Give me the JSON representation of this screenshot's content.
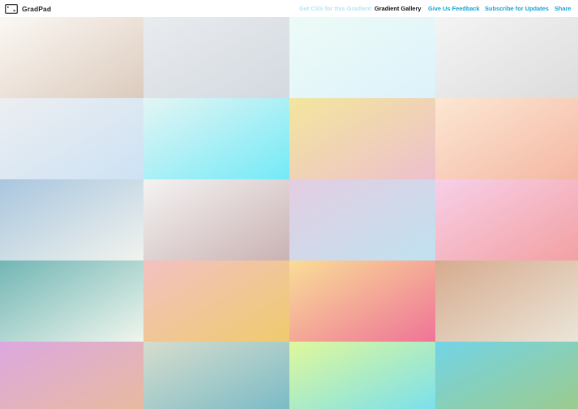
{
  "app": {
    "logo_text": "GradPad",
    "logo_icon": "window-frame-icon"
  },
  "nav": {
    "get_css": "Get CSS for this Gradient",
    "gallery": "Gradient Gallery",
    "feedback": "Give Us Feedback",
    "subscribe": "Subscribe for Updates",
    "share": "Share"
  },
  "colors": {
    "nav_muted": "#b9e4f3",
    "nav_active": "#111111",
    "nav_link": "#19a4d4"
  },
  "gradients": [
    [
      "#fbf8f4",
      "#dccbbd"
    ],
    [
      "#e9ecef",
      "#d3d9e0"
    ],
    [
      "#edfbf6",
      "#dcf2fb"
    ],
    [
      "#f4f4f4",
      "#dcdcdc"
    ],
    [
      "#eceef1",
      "#cde2f4"
    ],
    [
      "#e4f5f4",
      "#73eaf7"
    ],
    [
      "#f3e69c",
      "#edc0cd"
    ],
    [
      "#fce7d3",
      "#f4b8a4"
    ],
    [
      "#a9c6df",
      "#f1f3ed"
    ],
    [
      "#f4f3f2",
      "#cab2b3"
    ],
    [
      "#e4cde2",
      "#bfe2f0"
    ],
    [
      "#f7cfe8",
      "#f3a1a3"
    ],
    [
      "#72b6b5",
      "#eff6ed"
    ],
    [
      "#f3c1c2",
      "#efcb6d"
    ],
    [
      "#f9dd97",
      "#ef7497"
    ],
    [
      "#d6ab8e",
      "#ebe5d8"
    ],
    [
      "#dca8e0",
      "#e8ba9f"
    ],
    [
      "#d6ddcd",
      "#7bbbc6"
    ],
    [
      "#e0f89b",
      "#7be0ec"
    ],
    [
      "#72d4e6",
      "#9ccb8e"
    ]
  ]
}
